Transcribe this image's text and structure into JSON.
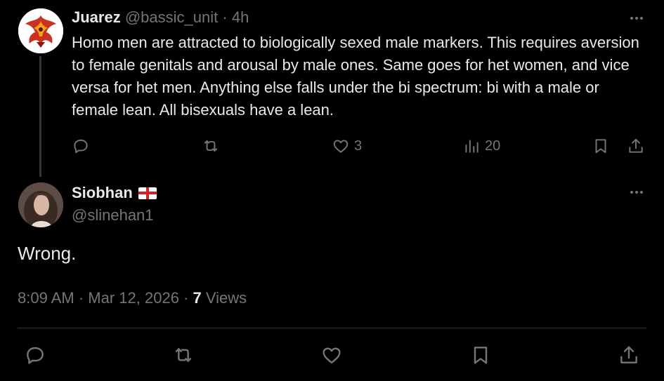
{
  "parent_tweet": {
    "author_name": "Juarez",
    "handle": "@bassic_unit",
    "separator": "·",
    "time": "4h",
    "text": "Homo men are attracted to biologically sexed male markers. This requires aversion to female genitals and arousal by male ones. Same goes for het women, and vice versa for het men. Anything else falls under the bi spectrum: bi with a male or female lean. All bisexuals have a lean.",
    "likes": "3",
    "views": "20",
    "icons": [
      "reply-icon",
      "retweet-icon",
      "like-icon",
      "views-icon",
      "bookmark-icon",
      "share-icon"
    ]
  },
  "main_tweet": {
    "author_name": "Siobhan",
    "flag": "england-flag-icon",
    "handle": "@slinehan1",
    "text": "Wrong.",
    "time": "8:09 AM",
    "date": "Mar 12, 2026",
    "separator": "·",
    "views_count": "7",
    "views_label": "Views",
    "icons": [
      "reply-icon",
      "retweet-icon",
      "like-icon",
      "bookmark-icon",
      "share-icon"
    ]
  },
  "colors": {
    "background": "#000000",
    "text": "#e7e9ea",
    "muted": "#71767b",
    "divider": "#2f3336"
  }
}
